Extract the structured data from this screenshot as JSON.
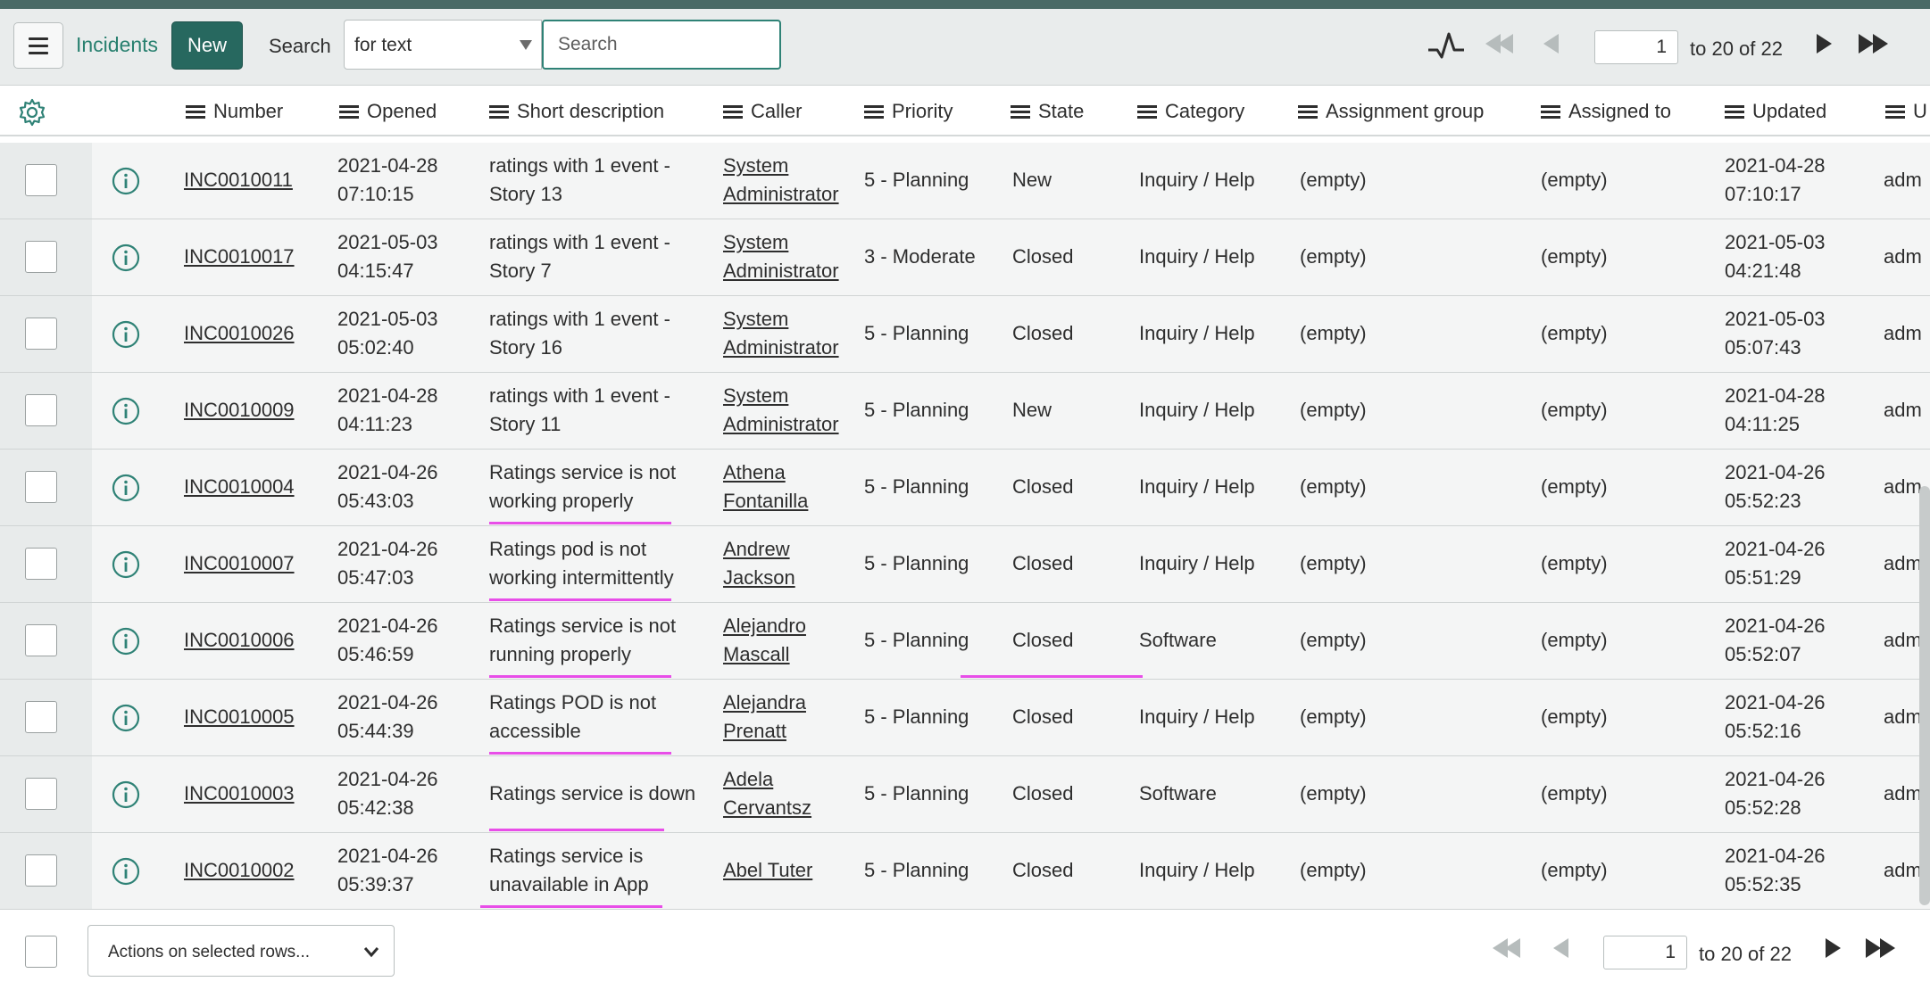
{
  "toolbar": {
    "list_title": "Incidents",
    "new_label": "New",
    "search_label": "Search",
    "search_field_value": "for text",
    "search_placeholder": "Search",
    "page_value": "1",
    "page_range": "to 20 of 22"
  },
  "columns": [
    "Number",
    "Opened",
    "Short description",
    "Caller",
    "Priority",
    "State",
    "Category",
    "Assignment group",
    "Assigned to",
    "Updated",
    "U"
  ],
  "rows": [
    {
      "number": "INC0010011",
      "opened": [
        "2021-04-28",
        "07:10:15"
      ],
      "short_description": [
        "ratings with 1 event -",
        "Story 13"
      ],
      "caller": [
        "System",
        "Administrator"
      ],
      "priority": "5 - Planning",
      "state": "New",
      "category": "Inquiry / Help",
      "assignment_group": "(empty)",
      "assigned_to": "(empty)",
      "updated": [
        "2021-04-28",
        "07:10:17"
      ],
      "updated_by": "adm"
    },
    {
      "number": "INC0010017",
      "opened": [
        "2021-05-03",
        "04:15:47"
      ],
      "short_description": [
        "ratings with 1 event -",
        "Story 7"
      ],
      "caller": [
        "System",
        "Administrator"
      ],
      "priority": "3 - Moderate",
      "state": "Closed",
      "category": "Inquiry / Help",
      "assignment_group": "(empty)",
      "assigned_to": "(empty)",
      "updated": [
        "2021-05-03",
        "04:21:48"
      ],
      "updated_by": "adm"
    },
    {
      "number": "INC0010026",
      "opened": [
        "2021-05-03",
        "05:02:40"
      ],
      "short_description": [
        "ratings with 1 event -",
        "Story 16"
      ],
      "caller": [
        "System",
        "Administrator"
      ],
      "priority": "5 - Planning",
      "state": "Closed",
      "category": "Inquiry / Help",
      "assignment_group": "(empty)",
      "assigned_to": "(empty)",
      "updated": [
        "2021-05-03",
        "05:07:43"
      ],
      "updated_by": "adm"
    },
    {
      "number": "INC0010009",
      "opened": [
        "2021-04-28",
        "04:11:23"
      ],
      "short_description": [
        "ratings with 1 event -",
        "Story 11"
      ],
      "caller": [
        "System",
        "Administrator"
      ],
      "priority": "5 - Planning",
      "state": "New",
      "category": "Inquiry / Help",
      "assignment_group": "(empty)",
      "assigned_to": "(empty)",
      "updated": [
        "2021-04-28",
        "04:11:25"
      ],
      "updated_by": "adm"
    },
    {
      "number": "INC0010004",
      "opened": [
        "2021-04-26",
        "05:43:03"
      ],
      "short_description": [
        "Ratings service is not",
        "working properly"
      ],
      "caller": [
        "Athena",
        "Fontanilla"
      ],
      "priority": "5 - Planning",
      "state": "Closed",
      "category": "Inquiry / Help",
      "assignment_group": "(empty)",
      "assigned_to": "(empty)",
      "updated": [
        "2021-04-26",
        "05:52:23"
      ],
      "updated_by": "adm"
    },
    {
      "number": "INC0010007",
      "opened": [
        "2021-04-26",
        "05:47:03"
      ],
      "short_description": [
        "Ratings pod is not",
        "working intermittently"
      ],
      "caller": [
        "Andrew",
        "Jackson"
      ],
      "priority": "5 - Planning",
      "state": "Closed",
      "category": "Inquiry / Help",
      "assignment_group": "(empty)",
      "assigned_to": "(empty)",
      "updated": [
        "2021-04-26",
        "05:51:29"
      ],
      "updated_by": "adm"
    },
    {
      "number": "INC0010006",
      "opened": [
        "2021-04-26",
        "05:46:59"
      ],
      "short_description": [
        "Ratings service is not",
        "running properly"
      ],
      "caller": [
        "Alejandro",
        "Mascall"
      ],
      "priority": "5 - Planning",
      "state": "Closed",
      "category": "Software",
      "assignment_group": "(empty)",
      "assigned_to": "(empty)",
      "updated": [
        "2021-04-26",
        "05:52:07"
      ],
      "updated_by": "adm"
    },
    {
      "number": "INC0010005",
      "opened": [
        "2021-04-26",
        "05:44:39"
      ],
      "short_description": [
        "Ratings POD is not",
        "accessible"
      ],
      "caller": [
        "Alejandra",
        "Prenatt"
      ],
      "priority": "5 - Planning",
      "state": "Closed",
      "category": "Inquiry / Help",
      "assignment_group": "(empty)",
      "assigned_to": "(empty)",
      "updated": [
        "2021-04-26",
        "05:52:16"
      ],
      "updated_by": "adm"
    },
    {
      "number": "INC0010003",
      "opened": [
        "2021-04-26",
        "05:42:38"
      ],
      "short_description": [
        "Ratings service is down"
      ],
      "caller": [
        "Adela",
        "Cervantsz"
      ],
      "priority": "5 - Planning",
      "state": "Closed",
      "category": "Software",
      "assignment_group": "(empty)",
      "assigned_to": "(empty)",
      "updated": [
        "2021-04-26",
        "05:52:28"
      ],
      "updated_by": "adm"
    },
    {
      "number": "INC0010002",
      "opened": [
        "2021-04-26",
        "05:39:37"
      ],
      "short_description": [
        "Ratings service is",
        "unavailable in App"
      ],
      "caller": [
        "Abel Tuter"
      ],
      "priority": "5 - Planning",
      "state": "Closed",
      "category": "Inquiry / Help",
      "assignment_group": "(empty)",
      "assigned_to": "(empty)",
      "updated": [
        "2021-04-26",
        "05:52:35"
      ],
      "updated_by": "adm"
    }
  ],
  "footer": {
    "actions_label": "Actions on selected rows...",
    "page_value": "1",
    "page_range": "to 20 of 22"
  },
  "colors": {
    "accent": "#27685f",
    "title_green": "#28806f",
    "highlight_pink": "#e84ee8"
  },
  "icons": [
    "menu-icon",
    "activity-stream-icon",
    "first-page-icon",
    "previous-page-icon",
    "next-page-icon",
    "last-page-icon",
    "gear-icon",
    "info-icon",
    "chevron-down-icon"
  ]
}
